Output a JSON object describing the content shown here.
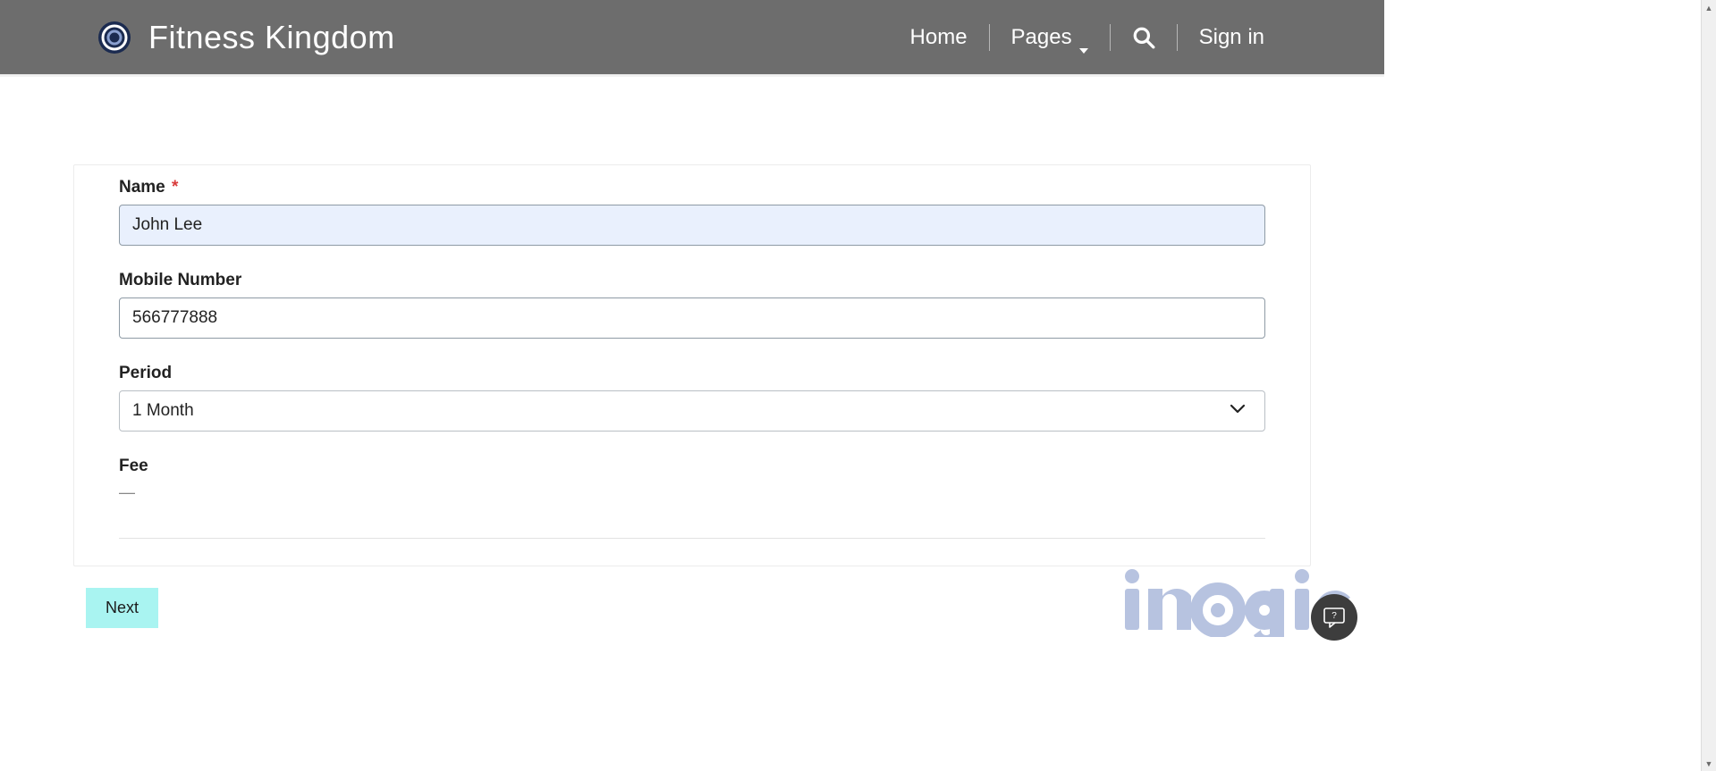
{
  "header": {
    "brand": "Fitness Kingdom",
    "nav": {
      "home": "Home",
      "pages": "Pages",
      "signin": "Sign in"
    }
  },
  "form": {
    "name": {
      "label": "Name",
      "value": "John Lee"
    },
    "mobile": {
      "label": "Mobile Number",
      "value": "566777888"
    },
    "period": {
      "label": "Period",
      "selected": "1 Month"
    },
    "fee": {
      "label": "Fee",
      "value": "—"
    }
  },
  "actions": {
    "next": "Next"
  },
  "watermark": "inogic"
}
